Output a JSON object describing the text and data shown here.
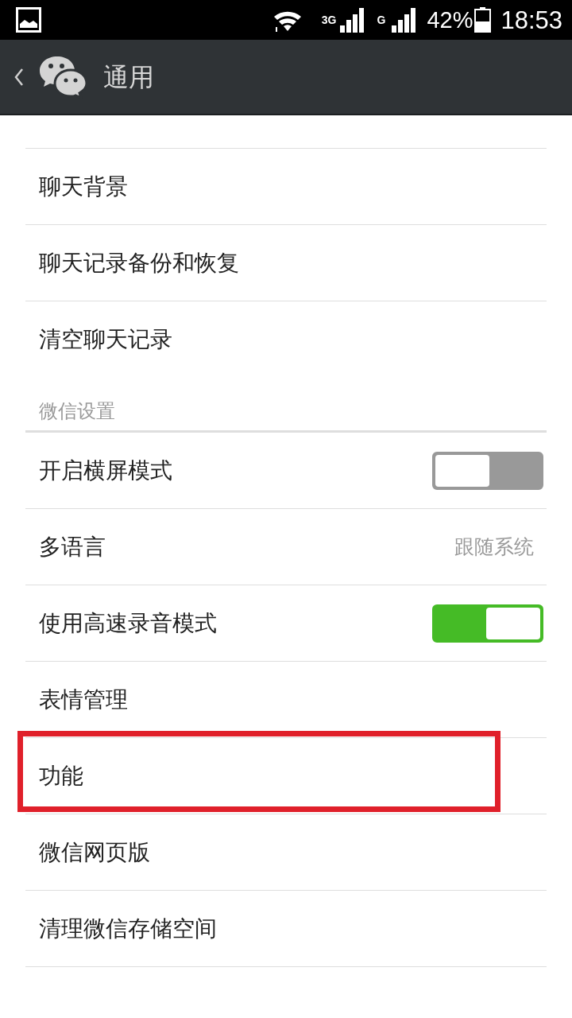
{
  "status_bar": {
    "network_1": "3G",
    "network_2": "G",
    "battery": "42%",
    "time": "18:53"
  },
  "header": {
    "title": "通用"
  },
  "groups": [
    {
      "items": [
        {
          "kind": "plain",
          "label": "聊天背景",
          "highlighted": false
        },
        {
          "kind": "plain",
          "label": "聊天记录备份和恢复",
          "highlighted": false
        },
        {
          "kind": "plain",
          "label": "清空聊天记录",
          "highlighted": false
        }
      ]
    },
    {
      "title": "微信设置",
      "items": [
        {
          "kind": "toggle",
          "label": "开启横屏模式",
          "on": false,
          "highlighted": false
        },
        {
          "kind": "value",
          "label": "多语言",
          "value": "跟随系统",
          "highlighted": false
        },
        {
          "kind": "toggle",
          "label": "使用高速录音模式",
          "on": true,
          "highlighted": false
        },
        {
          "kind": "plain",
          "label": "表情管理",
          "highlighted": false
        },
        {
          "kind": "plain",
          "label": "功能",
          "highlighted": true
        },
        {
          "kind": "plain",
          "label": "微信网页版",
          "highlighted": false
        },
        {
          "kind": "plain",
          "label": "清理微信存储空间",
          "highlighted": false
        }
      ]
    }
  ]
}
